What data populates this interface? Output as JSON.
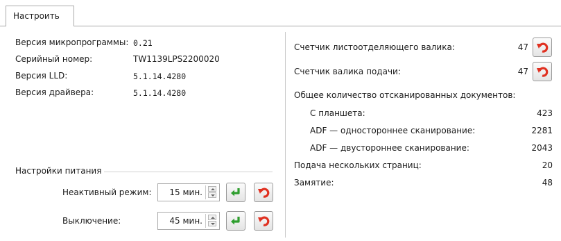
{
  "tab": {
    "label": "Настроить"
  },
  "device_info": {
    "firmware_label": "Версия микропрограммы:",
    "firmware_value": "0.21",
    "serial_label": "Серийный номер:",
    "serial_value": "TW1139LPS2200020",
    "lld_label": "Версия LLD:",
    "lld_value": "5.1.14.4280",
    "driver_label": "Версия драйвера:",
    "driver_value": "5.1.14.4280"
  },
  "power": {
    "group_label": "Настройки питания",
    "sleep_label": "Неактивный режим:",
    "sleep_value": "15 мин.",
    "off_label": "Выключение:",
    "off_value": "45 мин."
  },
  "counters": {
    "separation_roller_label": "Счетчик листоотделяющего валика:",
    "separation_roller_value": "47",
    "feed_roller_label": "Счетчик валика подачи:",
    "feed_roller_value": "47",
    "total_label": "Общее количество отсканированных документов:",
    "flatbed_label": "С планшета:",
    "flatbed_value": "423",
    "adf_simplex_label": "ADF — одностороннее сканирование:",
    "adf_simplex_value": "2281",
    "adf_duplex_label": "ADF — двустороннее сканирование:",
    "adf_duplex_value": "2043",
    "multifeed_label": "Подача нескольких страниц:",
    "multifeed_value": "20",
    "jam_label": "Замятие:",
    "jam_value": "48"
  },
  "icons": {
    "apply": "green-enter-arrow-icon",
    "reset": "red-undo-arrow-icon"
  }
}
